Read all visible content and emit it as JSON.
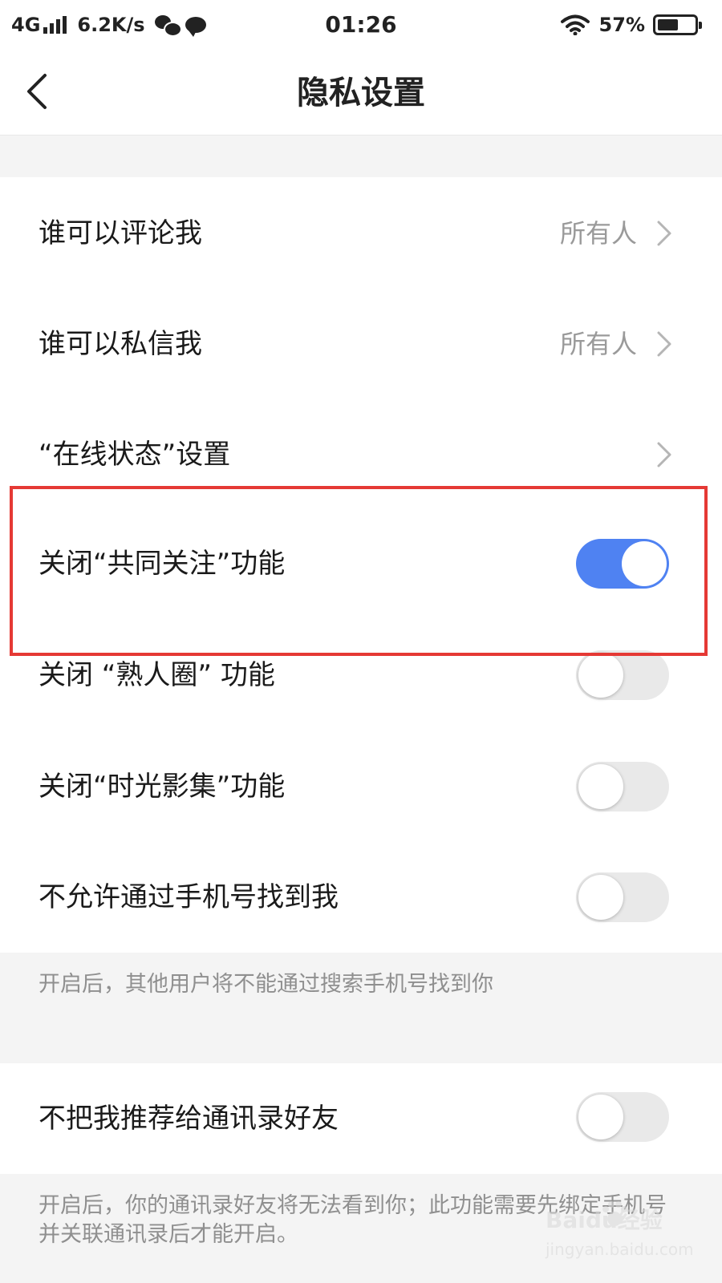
{
  "status_bar": {
    "network": "4G",
    "speed": "6.2K/s",
    "time": "01:26",
    "battery_percent": "57%",
    "battery_level": 0.57
  },
  "header": {
    "title": "隐私设置"
  },
  "settings": [
    {
      "label": "谁可以评论我",
      "value": "所有人",
      "type": "nav"
    },
    {
      "label": "谁可以私信我",
      "value": "所有人",
      "type": "nav"
    },
    {
      "label": "“在线状态”设置",
      "type": "nav"
    },
    {
      "label": "关闭“共同关注”功能",
      "type": "toggle",
      "on": true
    },
    {
      "label": "关闭 “熟人圈” 功能",
      "type": "toggle",
      "on": false
    },
    {
      "label": "关闭“时光影集”功能",
      "type": "toggle",
      "on": false
    },
    {
      "label": "不允许通过手机号找到我",
      "type": "toggle",
      "on": false
    },
    {
      "label": "不把我推荐给通讯录好友",
      "type": "toggle",
      "on": false
    }
  ],
  "notes": {
    "phone_search": "开启后，其他用户将不能通过搜索手机号找到你",
    "contacts": "开启后，你的通讯录好友将无法看到你；此功能需要先绑定手机号并关联通讯录后才能开启。"
  },
  "watermark": {
    "brand": "Baidu经验",
    "url": "jingyan.baidu.com"
  },
  "colors": {
    "toggle_on": "#4f82f2",
    "toggle_off": "#e9e9e9",
    "highlight_border": "#e53935",
    "section_background": "#f4f4f4"
  }
}
